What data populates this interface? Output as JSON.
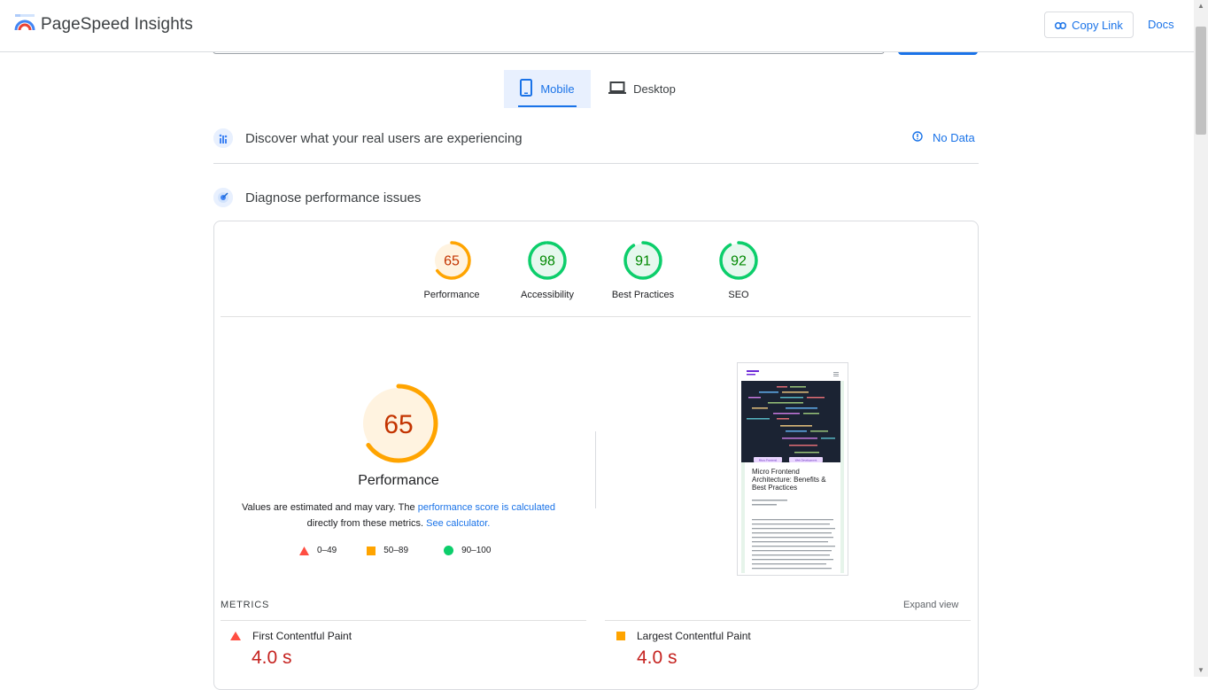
{
  "header": {
    "brand": "PageSpeed Insights",
    "copy_link": "Copy Link",
    "docs": "Docs"
  },
  "device_tabs": [
    {
      "label": "Mobile",
      "active": true,
      "icon": "smartphone-icon"
    },
    {
      "label": "Desktop",
      "active": false,
      "icon": "laptop-icon"
    }
  ],
  "field_data": {
    "title": "Discover what your real users are experiencing",
    "status": "No Data"
  },
  "lab_data": {
    "title": "Diagnose performance issues"
  },
  "categories": [
    {
      "label": "Performance",
      "score": "65",
      "value": 65,
      "rating": "average"
    },
    {
      "label": "Accessibility",
      "score": "98",
      "value": 98,
      "rating": "pass"
    },
    {
      "label": "Best Practices",
      "score": "91",
      "value": 91,
      "rating": "pass"
    },
    {
      "label": "SEO",
      "score": "92",
      "value": 92,
      "rating": "pass"
    }
  ],
  "performance": {
    "score": "65",
    "value": 65,
    "label": "Performance",
    "desc_pre": "Values are estimated and may vary. The ",
    "desc_link1": "performance score is calculated",
    "desc_mid": " directly from these metrics. ",
    "desc_link2": "See calculator.",
    "legend": [
      {
        "range": "0–49",
        "shape": "triangle"
      },
      {
        "range": "50–89",
        "shape": "square"
      },
      {
        "range": "90–100",
        "shape": "circle"
      }
    ]
  },
  "screenshot": {
    "tags": [
      "Micro Frontend",
      "Web Development"
    ],
    "headline": "Micro Frontend Architecture: Benefits & Best Practices"
  },
  "metrics": {
    "title": "METRICS",
    "expand": "Expand view",
    "items": [
      {
        "name": "First Contentful Paint",
        "value": "4.0 s",
        "rating": "fail"
      },
      {
        "name": "Largest Contentful Paint",
        "value": "4.0 s",
        "rating": "average"
      }
    ]
  },
  "colors": {
    "accent": "#1a73e8",
    "pass": "#0cce6b",
    "pass_text": "#008800",
    "average": "#ffa400",
    "average_text": "#c33300",
    "fail": "#ff4e42"
  }
}
